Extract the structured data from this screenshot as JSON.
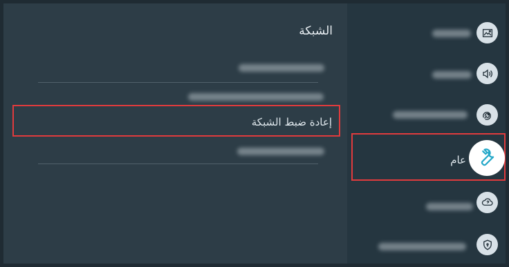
{
  "main": {
    "title": "الشبكة",
    "selected_item": "إعادة ضبط الشبكة"
  },
  "sidebar": {
    "selected_item": "عام",
    "icons": [
      "picture-icon",
      "sound-icon",
      "broadcast-icon",
      "wrench-icon",
      "support-icon",
      "privacy-shield-icon"
    ]
  },
  "colors": {
    "highlight": "#e13b3d",
    "panel": "#2d3d47",
    "sidebar": "#253640"
  }
}
